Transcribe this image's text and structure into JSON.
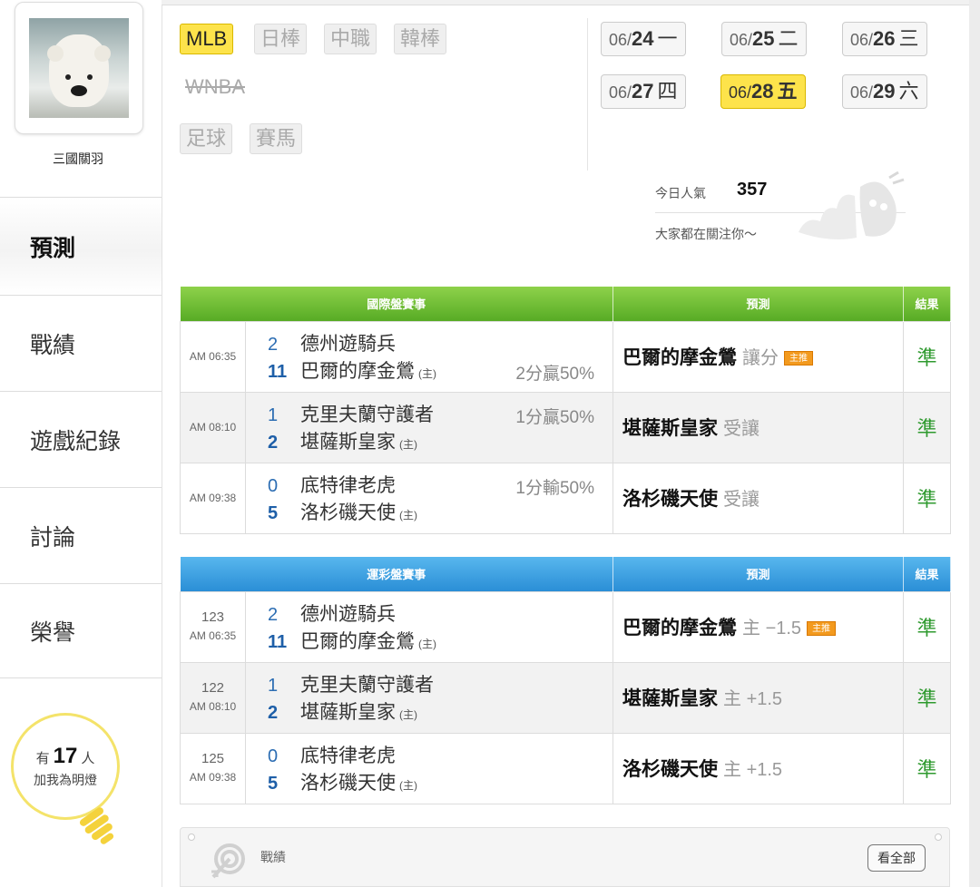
{
  "profile": {
    "username": "三國關羽"
  },
  "sidebar": {
    "items": [
      {
        "label": "預測",
        "active": true
      },
      {
        "label": "戰績",
        "active": false
      },
      {
        "label": "遊戲紀錄",
        "active": false
      },
      {
        "label": "討論",
        "active": false
      },
      {
        "label": "榮譽",
        "active": false
      }
    ],
    "lights": {
      "prefix": "有",
      "count": "17",
      "suffix": "人",
      "caption": "加我為明燈"
    }
  },
  "leagues": [
    {
      "label": "MLB",
      "active": true
    },
    {
      "label": "日棒",
      "active": false
    },
    {
      "label": "中職",
      "active": false
    },
    {
      "label": "韓棒",
      "active": false
    },
    {
      "label": "WNBA",
      "active": false
    },
    {
      "label": "足球",
      "active": false
    },
    {
      "label": "賽馬",
      "active": false
    }
  ],
  "dates": [
    {
      "month": "06/",
      "day": "24",
      "weekday": "一",
      "active": false
    },
    {
      "month": "06/",
      "day": "25",
      "weekday": "二",
      "active": false
    },
    {
      "month": "06/",
      "day": "26",
      "weekday": "三",
      "active": false
    },
    {
      "month": "06/",
      "day": "27",
      "weekday": "四",
      "active": false
    },
    {
      "month": "06/",
      "day": "28",
      "weekday": "五",
      "active": true
    },
    {
      "month": "06/",
      "day": "29",
      "weekday": "六",
      "active": false
    }
  ],
  "popularity": {
    "label": "今日人氣",
    "value": "357",
    "note": "大家都在關注你～"
  },
  "intl_table": {
    "headers": [
      "國際盤賽事",
      "預測",
      "結果"
    ],
    "rows": [
      {
        "time": "AM 06:35",
        "away_score": "2",
        "away": "德州遊騎兵",
        "home_score": "11",
        "home": "巴爾的摩金鶯",
        "home_tag": "(主)",
        "odds": "2分贏50%",
        "odds_row": "home",
        "pick": "巴爾的摩金鶯",
        "handicap": "讓分",
        "badge": "主推",
        "result": "準"
      },
      {
        "time": "AM 08:10",
        "away_score": "1",
        "away": "克里夫蘭守護者",
        "home_score": "2",
        "home": "堪薩斯皇家",
        "home_tag": "(主)",
        "odds": "1分贏50%",
        "odds_row": "away",
        "pick": "堪薩斯皇家",
        "handicap": "受讓",
        "badge": "",
        "result": "準"
      },
      {
        "time": "AM 09:38",
        "away_score": "0",
        "away": "底特律老虎",
        "home_score": "5",
        "home": "洛杉磯天使",
        "home_tag": "(主)",
        "odds": "1分輸50%",
        "odds_row": "away",
        "pick": "洛杉磯天使",
        "handicap": "受讓",
        "badge": "",
        "result": "準"
      }
    ]
  },
  "lottery_table": {
    "headers": [
      "運彩盤賽事",
      "預測",
      "結果"
    ],
    "rows": [
      {
        "num": "123",
        "time": "AM 06:35",
        "away_score": "2",
        "away": "德州遊騎兵",
        "home_score": "11",
        "home": "巴爾的摩金鶯",
        "home_tag": "(主)",
        "pick": "巴爾的摩金鶯",
        "handicap": "主 −1.5",
        "badge": "主推",
        "result": "準"
      },
      {
        "num": "122",
        "time": "AM 08:10",
        "away_score": "1",
        "away": "克里夫蘭守護者",
        "home_score": "2",
        "home": "堪薩斯皇家",
        "home_tag": "(主)",
        "pick": "堪薩斯皇家",
        "handicap": "主 +1.5",
        "badge": "",
        "result": "準"
      },
      {
        "num": "125",
        "time": "AM 09:38",
        "away_score": "0",
        "away": "底特律老虎",
        "home_score": "5",
        "home": "洛杉磯天使",
        "home_tag": "(主)",
        "pick": "洛杉磯天使",
        "handicap": "主 +1.5",
        "badge": "",
        "result": "準"
      }
    ]
  },
  "bottom": {
    "label": "戰績",
    "button": "看全部"
  },
  "colors": {
    "accent_yellow": "#fde34b",
    "table_green": "#57ab25",
    "table_blue": "#2a8ed6",
    "result_green": "#2f9a2f",
    "score_blue": "#2c6db3",
    "badge_orange": "#f39a1e"
  },
  "icons": {
    "bulb": "lightbulb-icon",
    "target": "target-icon",
    "mascot": "mascot-doodle-icon"
  }
}
